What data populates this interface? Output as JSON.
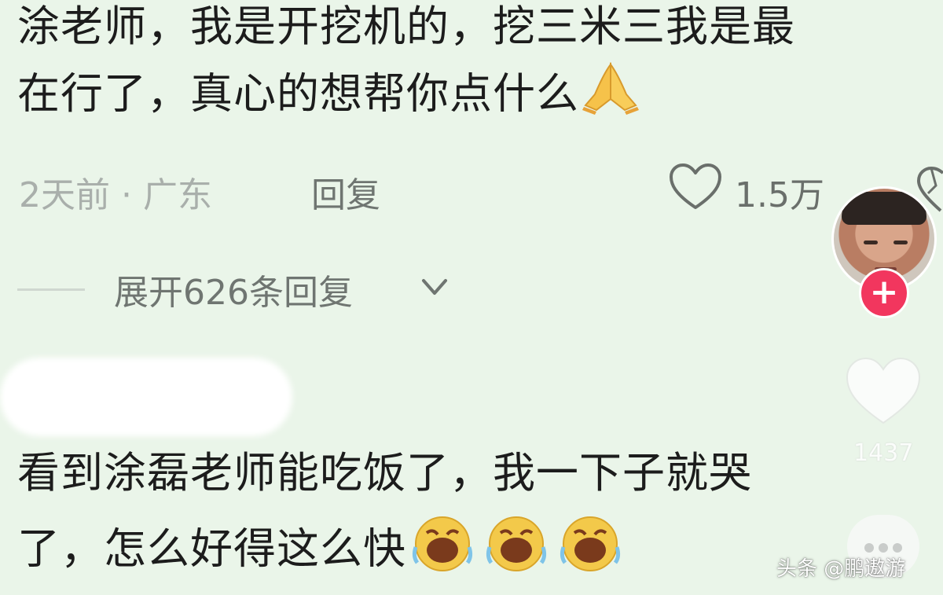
{
  "comment1": {
    "line1": "涂老师，我是开挖机的，挖三米三我是最",
    "line2": "在行了，真心的想帮你点什么",
    "emoji": "praying-hands",
    "time_location": "2天前 · 广东",
    "reply_label": "回复",
    "like_count": "1.5万",
    "expand_label": "展开626条回复"
  },
  "comment2": {
    "line1": "看到涂磊老师能吃饭了，我一下子就哭",
    "line2": "了，怎么好得这么快",
    "emoji": "crying-face"
  },
  "sidebar": {
    "follow_label": "+",
    "like_count": "1437"
  },
  "watermark": "头条 @鹏遨游",
  "colors": {
    "background": "#eaf5e9",
    "follow_button": "#f2365e",
    "meta_text": "#a9afab"
  }
}
